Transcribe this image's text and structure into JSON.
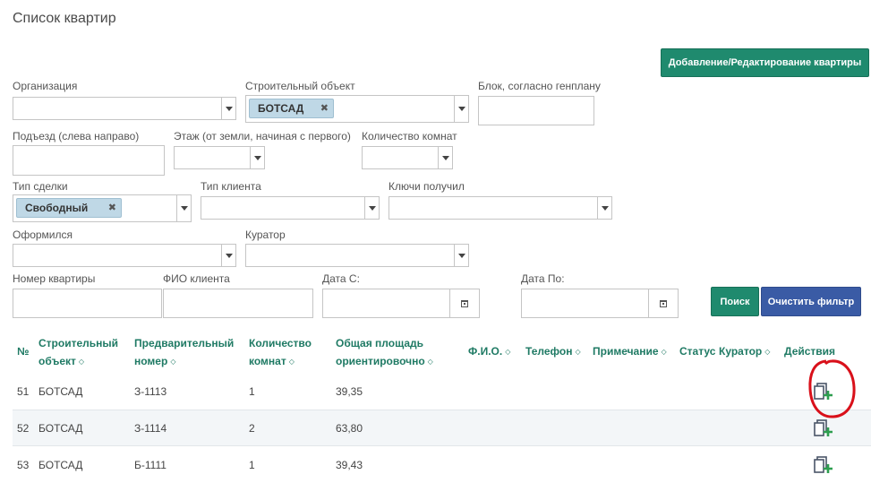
{
  "page": {
    "title": "Список квартир"
  },
  "toolbar": {
    "add_edit_label": "Добавление/Редактирование квартиры"
  },
  "filters": {
    "organization": {
      "label": "Организация",
      "value": ""
    },
    "construction_object": {
      "label": "Строительный объект",
      "chip": "БОТСАД"
    },
    "block": {
      "label": "Блок, согласно генплану",
      "value": ""
    },
    "entrance": {
      "label": "Подъезд (слева направо)",
      "value": ""
    },
    "floor": {
      "label": "Этаж (от земли, начиная с первого)",
      "value": ""
    },
    "rooms": {
      "label": "Количество комнат",
      "value": ""
    },
    "deal_type": {
      "label": "Тип сделки",
      "chip": "Свободный"
    },
    "client_type": {
      "label": "Тип клиента",
      "value": ""
    },
    "keys_received": {
      "label": "Ключи получил",
      "value": ""
    },
    "registered": {
      "label": "Оформился",
      "value": ""
    },
    "curator": {
      "label": "Куратор",
      "value": ""
    },
    "apartment_number": {
      "label": "Номер квартиры",
      "value": ""
    },
    "client_name": {
      "label": "ФИО клиента",
      "value": ""
    },
    "date_from": {
      "label": "Дата С:",
      "value": ""
    },
    "date_to": {
      "label": "Дата По:",
      "value": ""
    },
    "search_label": "Поиск",
    "clear_label": "Очистить фильтр"
  },
  "table": {
    "columns": {
      "num": "№",
      "object_1": "Строительный",
      "object_2": "объект",
      "prelim_1": "Предварительный",
      "prelim_2": "номер",
      "rooms_1": "Количество",
      "rooms_2": "комнат",
      "area_1": "Общая площадь",
      "area_2": "ориентировочно",
      "fio": "Ф.И.О.",
      "phone": "Телефон",
      "note": "Примечание",
      "status": "Статус",
      "curator": "Куратор",
      "actions": "Действия"
    },
    "rows": [
      {
        "num": "51",
        "object": "БОТСАД",
        "prelim": "З-1113",
        "rooms": "1",
        "area": "39,35"
      },
      {
        "num": "52",
        "object": "БОТСАД",
        "prelim": "З-1114",
        "rooms": "2",
        "area": "63,80"
      },
      {
        "num": "53",
        "object": "БОТСАД",
        "prelim": "Б-1111",
        "rooms": "1",
        "area": "39,43"
      }
    ]
  },
  "colors": {
    "accent_green": "#1f8a6e",
    "accent_blue": "#3a5ba5",
    "highlight_red": "#d9101a",
    "chip_bg": "#bfd8e6"
  },
  "icons": {
    "row_action": "edit-add-icon",
    "dropdown": "chevron-down-icon",
    "date": "calendar-icon"
  }
}
